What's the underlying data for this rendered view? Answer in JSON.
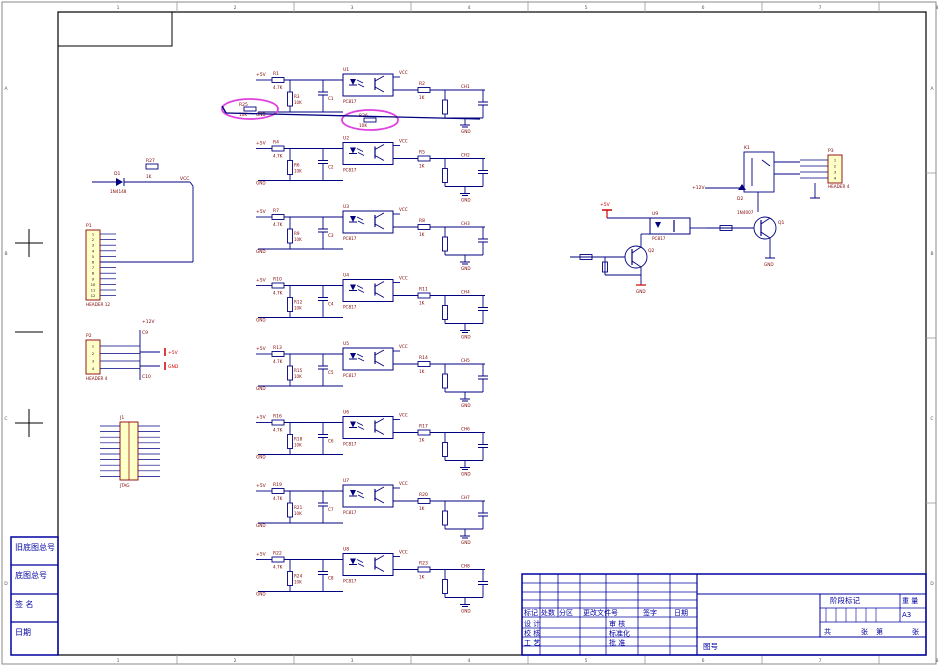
{
  "sheet": {
    "paper": "A3",
    "border_color": "#0000a0",
    "wire_color": "#000080",
    "frame_color": "#000000",
    "label_color": "#7f0000",
    "power_color": "#d00000",
    "highlight_color": "#e040e0",
    "component_fill": "#ffffc8",
    "top_ruler": [
      "1",
      "2",
      "3",
      "4",
      "5",
      "6",
      "7",
      "8"
    ],
    "side_ruler": [
      "A",
      "B",
      "C",
      "D"
    ]
  },
  "left_strip": {
    "labels": [
      "旧底图总号",
      "底图总号",
      "签 名",
      "日期"
    ]
  },
  "title_block": {
    "revision_headers": [
      "标记",
      "处数",
      "分区",
      "更改文件号",
      "签字",
      "日期"
    ],
    "roles_left": [
      "设 计",
      "校 核",
      "工 艺"
    ],
    "roles_mid": [
      "审 核",
      "标准化",
      "批 准"
    ],
    "stage_label": "阶段标记",
    "weight_label": "重 量",
    "scale_label": "比 例",
    "paper": "A3",
    "count_row": [
      "共",
      "张",
      "第",
      "张"
    ],
    "drawing_no_label": "图号"
  },
  "channels": [
    {
      "res_in": "R1",
      "opto": "U1",
      "res_out": "R2",
      "res_pd": "R3",
      "cap": "C1",
      "net_out": "CH1"
    },
    {
      "res_in": "R4",
      "opto": "U2",
      "res_out": "R5",
      "res_pd": "R6",
      "cap": "C2",
      "net_out": "CH2"
    },
    {
      "res_in": "R7",
      "opto": "U3",
      "res_out": "R8",
      "res_pd": "R9",
      "cap": "C3",
      "net_out": "CH3"
    },
    {
      "res_in": "R10",
      "opto": "U4",
      "res_out": "R11",
      "res_pd": "R12",
      "cap": "C4",
      "net_out": "CH4"
    },
    {
      "res_in": "R13",
      "opto": "U5",
      "res_out": "R14",
      "res_pd": "R15",
      "cap": "C5",
      "net_out": "CH5"
    },
    {
      "res_in": "R16",
      "opto": "U6",
      "res_out": "R17",
      "res_pd": "R18",
      "cap": "C6",
      "net_out": "CH6"
    },
    {
      "res_in": "R19",
      "opto": "U7",
      "res_out": "R20",
      "res_pd": "R21",
      "cap": "C7",
      "net_out": "CH7"
    },
    {
      "res_in": "R22",
      "opto": "U8",
      "res_out": "R23",
      "res_pd": "R24",
      "cap": "C8",
      "net_out": "CH8"
    }
  ],
  "channel_values": {
    "res_in": "4.7K",
    "opto": "PC817",
    "res_out": "1K",
    "res_pd": "10K",
    "cap": "0.1uF",
    "net_in": "+5V",
    "gnd": "GND",
    "vcc_out": "VCC"
  },
  "highlights": [
    {
      "ref": "R25",
      "value": "10K"
    },
    {
      "ref": "R26",
      "value": "10K"
    }
  ],
  "left_parts": {
    "diode": {
      "ref": "D1",
      "value": "1N4148"
    },
    "resistor": {
      "ref": "R27",
      "value": "1K"
    },
    "connector_main": {
      "ref": "P1",
      "value": "HEADER 12"
    },
    "connector_power": {
      "ref": "P2",
      "value": "HEADER 4"
    },
    "connector_jtag": {
      "ref": "J1",
      "value": "JTAG"
    },
    "caps": [
      "C9",
      "C10"
    ],
    "net_labels": [
      "+5V",
      "GND",
      "+12V",
      "VCC"
    ]
  },
  "relay_circuit": {
    "relay": {
      "ref": "K1",
      "value": "RELAY"
    },
    "transistors": [
      "Q1",
      "Q2"
    ],
    "opto": {
      "ref": "U9",
      "value": "PC817"
    },
    "diode": {
      "ref": "D2",
      "value": "1N4007"
    },
    "connector": {
      "ref": "P3",
      "value": "HEADER 4"
    },
    "net_labels": [
      "+12V",
      "GND",
      "+5V"
    ]
  }
}
